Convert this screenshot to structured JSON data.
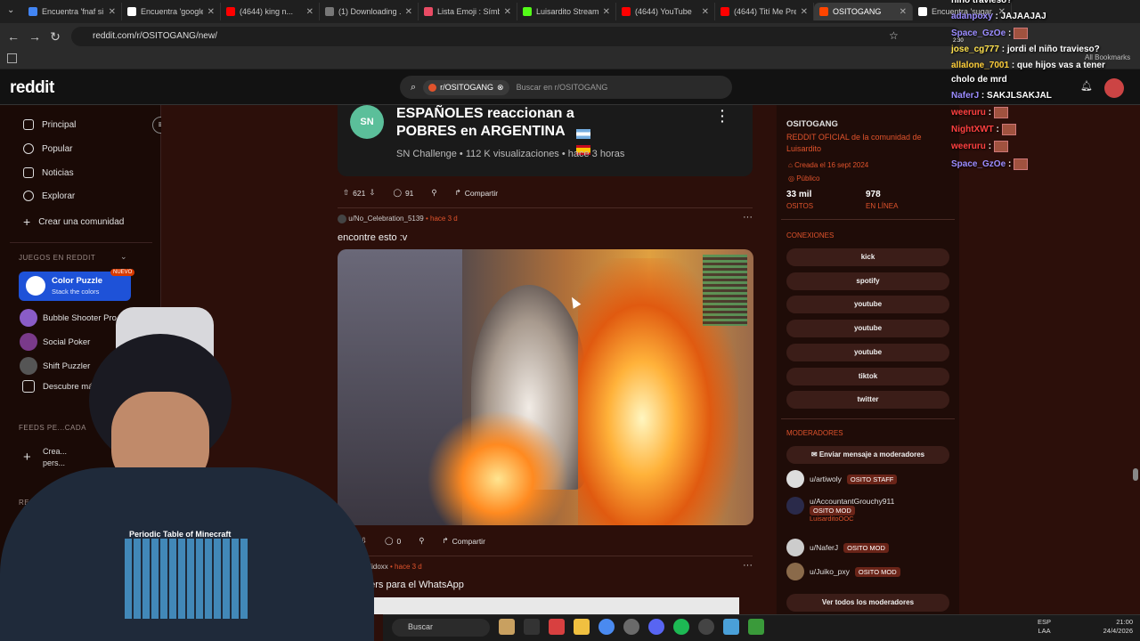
{
  "tabs": [
    {
      "title": "Encuentra 'fnaf si...",
      "color": "#4285f4"
    },
    {
      "title": "Encuentra 'google...",
      "color": "#ffffff"
    },
    {
      "title": "(4644) king n...",
      "color": "#ff0000"
    },
    {
      "title": "(1) Downloading ...",
      "color": "#777777"
    },
    {
      "title": "Lista Emoji : Símb...",
      "color": "#e94b64"
    },
    {
      "title": "Luisardito Stream...",
      "color": "#53fc18"
    },
    {
      "title": "(4644) YouTube",
      "color": "#ff0000"
    },
    {
      "title": "(4644) Tití Me Pre...",
      "color": "#ff0000"
    },
    {
      "title": "OSITOGANG",
      "color": "#ff4500",
      "active": true
    },
    {
      "title": "Encuentra 'sugar...",
      "color": "#ffffff"
    }
  ],
  "browser": {
    "url": "reddit.com/r/OSITOGANG/new/",
    "all_bookmarks": "All Bookmarks"
  },
  "reddit": {
    "logo": "reddit",
    "search_chip": "r/OSITOGANG",
    "search_placeholder": "Buscar en r/OSITOGANG"
  },
  "leftnav": {
    "items": [
      "Principal",
      "Popular",
      "Noticias",
      "Explorar",
      "Crear una comunidad"
    ],
    "games_header": "JUEGOS EN REDDIT",
    "featured_game": {
      "name": "Color Puzzle",
      "sub": "Stack the colors",
      "badge": "NUEVO"
    },
    "games": [
      "Bubble Shooter Pro",
      "Social Poker",
      "Shift Puzzler",
      "Descubre más"
    ],
    "feeds_header": "FEEDS PE...CADA",
    "create_feed": "Crea...",
    "create_feed_2": "pers...",
    "recent_header": "RECIENTE"
  },
  "feed": {
    "video_post": {
      "line1": "ESPAÑOLES reaccionan a",
      "line2": "POBRES en ARGENTINA",
      "channel_meta": "SN Challenge • 112 K visualizaciones • hace 3 horas",
      "votes": "621",
      "comments": "91",
      "share": "Compartir"
    },
    "post2": {
      "author": "u/No_Celebration_5139",
      "time": "• hace 3 d",
      "title": "encontre esto :v",
      "votes": "6",
      "comments": "0",
      "share": "Compartir"
    },
    "post3": {
      "author": "u/Gelidoxx",
      "time": "• hace 3 d",
      "title": "...ikers para el WhatsApp"
    }
  },
  "sidebar": {
    "name": "OSITOGANG",
    "desc": "REDDIT OFICIAL de la comunidad de Luisardito",
    "created": "Creada el 16 sept 2024",
    "visibility": "Público",
    "members": "33 mil",
    "members_label": "OSITOS",
    "online": "978",
    "online_label": "EN LÍNEA",
    "connections_header": "CONEXIONES",
    "connections": [
      "kick",
      "spotify",
      "youtube",
      "youtube",
      "youtube",
      "tiktok",
      "twitter"
    ],
    "mods_header": "MODERADORES",
    "message_mods": "Enviar mensaje a moderadores",
    "mods": [
      {
        "name": "u/artiwoly",
        "flair": "OSITO STAFF",
        "sub": ""
      },
      {
        "name": "u/AccountantGrouchy911",
        "flair": "OSITO MOD",
        "sub": "LuisarditoOOC"
      },
      {
        "name": "u/NaferJ",
        "flair": "OSITO MOD",
        "sub": ""
      },
      {
        "name": "u/Juiko_pxy",
        "flair": "OSITO MOD",
        "sub": ""
      }
    ],
    "view_all_mods": "Ver todos los moderadores"
  },
  "chat": [
    {
      "user": "",
      "text": "niño travieso?"
    },
    {
      "user": "adanpoxy",
      "text": ": JAJAAJAJ",
      "color": "u1"
    },
    {
      "user": "Space_GzOe",
      "text": ":",
      "color": "u1"
    },
    {
      "user": "jose_cg777",
      "text": ": jordi el niño travieso?",
      "color": "u2"
    },
    {
      "user": "allalone_7001",
      "text": ": que hijos vas a tener",
      "color": "u3"
    },
    {
      "user": "",
      "text": "cholo de mrd"
    },
    {
      "user": "NaferJ",
      "text": ": SAKJLSAKJAL",
      "color": "u1"
    },
    {
      "user": "weeruru",
      "text": ":",
      "color": "u4"
    },
    {
      "user": "NightXWT",
      "text": ":",
      "color": "u4"
    },
    {
      "user": "weeruru",
      "text": ":",
      "color": "u4"
    },
    {
      "user": "Space_GzOe",
      "text": ":",
      "color": "u1"
    }
  ],
  "chat_small": "2:30",
  "taskbar": {
    "search": "Buscar",
    "lang": "ESP",
    "lang2": "LAA",
    "time": "21:00",
    "date": "24/4/2026"
  }
}
